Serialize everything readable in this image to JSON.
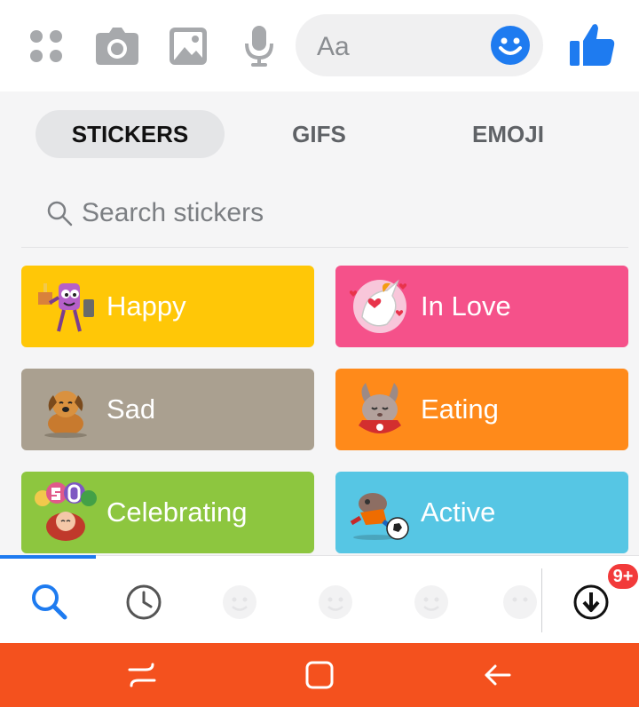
{
  "composer": {
    "icons": [
      "apps-grid-icon",
      "camera-icon",
      "gallery-icon",
      "microphone-icon"
    ],
    "input_placeholder": "Aa",
    "emoji_button_icon": "smiley-icon",
    "like_button_icon": "thumbs-up-icon",
    "accent_color": "#1e7bf0"
  },
  "tabs": [
    {
      "label": "STICKERS",
      "active": true
    },
    {
      "label": "GIFS",
      "active": false
    },
    {
      "label": "EMOJI",
      "active": false
    }
  ],
  "search": {
    "placeholder": "Search stickers",
    "icon": "search-icon"
  },
  "categories": [
    {
      "label": "Happy",
      "color": "#ffc707",
      "icon": "happy-sticker-icon"
    },
    {
      "label": "In Love",
      "color": "#f5518a",
      "icon": "unicorn-sticker-icon"
    },
    {
      "label": "Sad",
      "color": "#aaa090",
      "icon": "sad-dog-sticker-icon"
    },
    {
      "label": "Eating",
      "color": "#ff8a1a",
      "icon": "eating-bunny-sticker-icon"
    },
    {
      "label": "Celebrating",
      "color": "#8dc63f",
      "icon": "balloons-sticker-icon"
    },
    {
      "label": "Active",
      "color": "#56c6e4",
      "icon": "soccer-sticker-icon"
    }
  ],
  "pack_bar": {
    "items": [
      "search-icon",
      "recent-clock-icon",
      "pack-face-icon",
      "pack-face-icon",
      "pack-face-icon",
      "pack-face-icon"
    ],
    "store_icon": "download-icon",
    "badge": "9+"
  },
  "navbar": {
    "items": [
      "recent-apps-icon",
      "home-icon",
      "back-icon"
    ],
    "color": "#f4511e"
  }
}
